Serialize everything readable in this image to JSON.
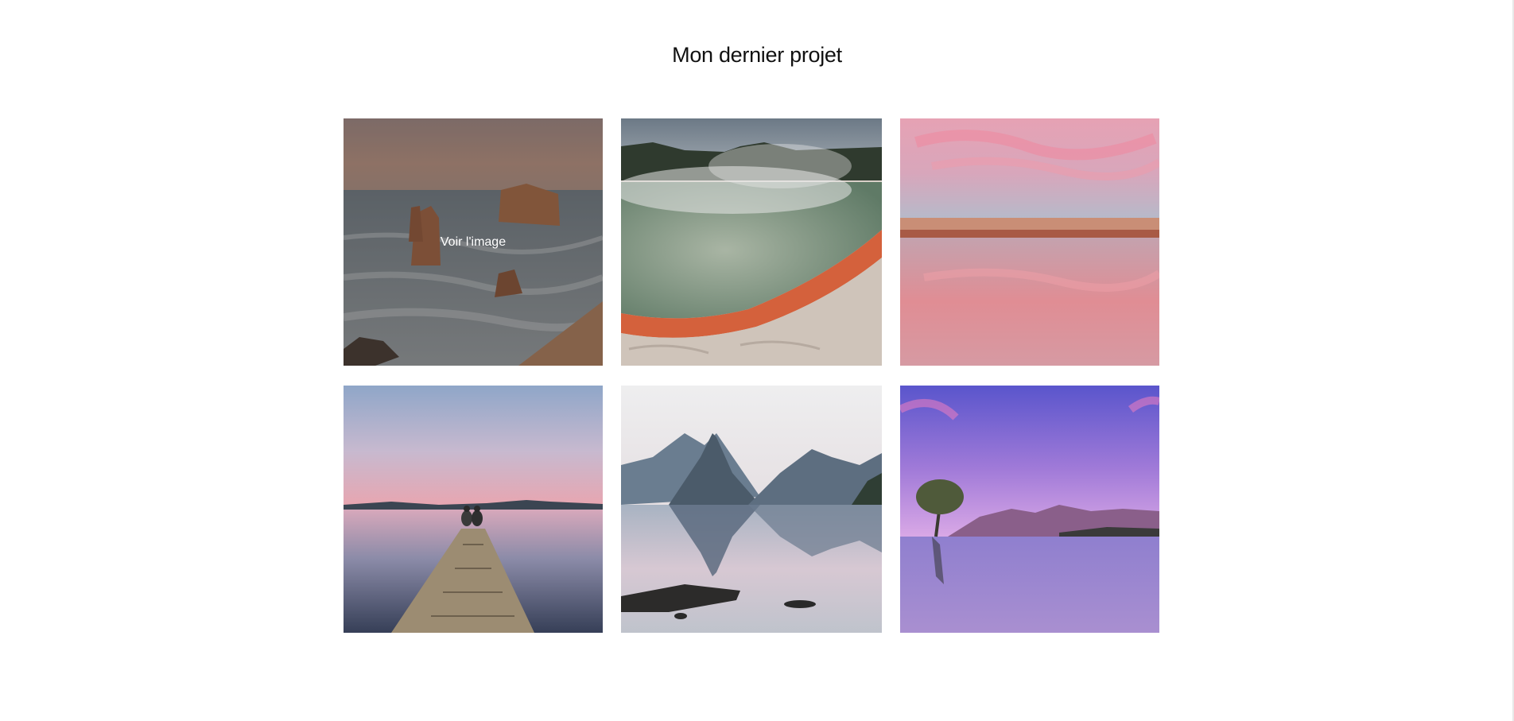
{
  "section": {
    "title": "Mon dernier projet"
  },
  "gallery": {
    "overlay_label": "Voir l'image",
    "items": [
      {
        "subject": "sea-stacks-coast",
        "hovered": true
      },
      {
        "subject": "hot-spring-steam",
        "hovered": false
      },
      {
        "subject": "pink-sky-beach-reflection",
        "hovered": false
      },
      {
        "subject": "couple-on-pier-dusk",
        "hovered": false
      },
      {
        "subject": "mountain-lake-reflection",
        "hovered": false
      },
      {
        "subject": "lone-tree-purple-lake",
        "hovered": false
      }
    ]
  },
  "colors": {
    "title": "#111111",
    "background": "#ffffff",
    "overlay_text": "#ffffff"
  }
}
